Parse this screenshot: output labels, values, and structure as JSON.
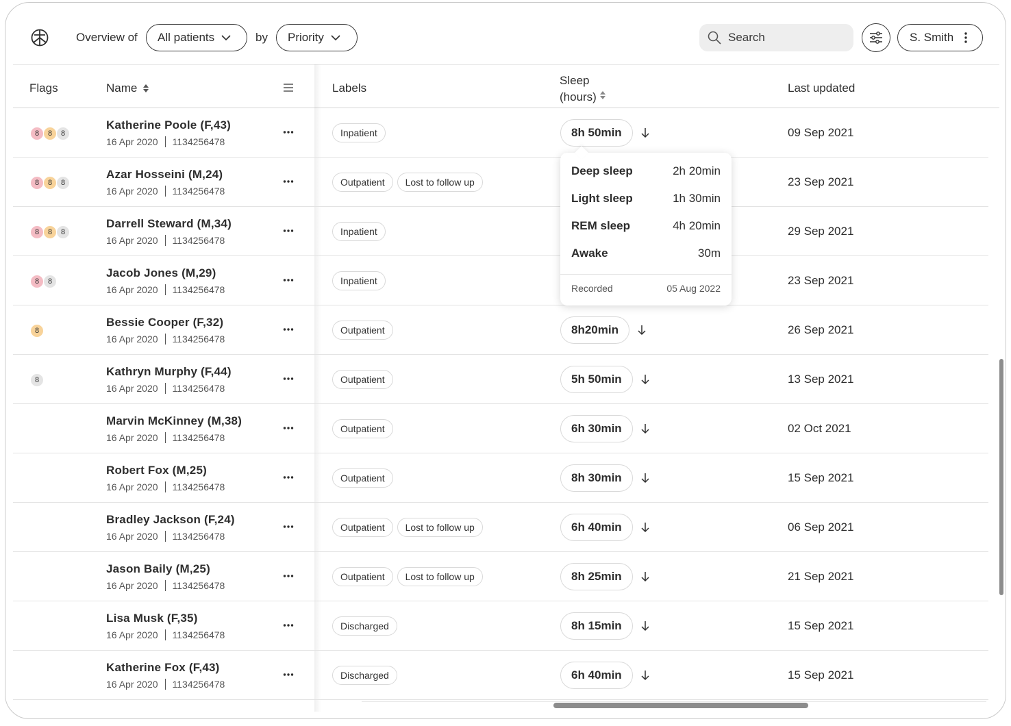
{
  "header": {
    "overview_label": "Overview of",
    "by_label": "by",
    "patients_filter": "All patients",
    "sort_by": "Priority",
    "search_placeholder": "Search",
    "user_name": "S. Smith"
  },
  "table": {
    "columns": {
      "flags": "Flags",
      "name": "Name",
      "labels": "Labels",
      "sleep_line1": "Sleep",
      "sleep_line2": "(hours)",
      "last_updated": "Last updated"
    },
    "rows": [
      {
        "name": "Katherine Poole (F,43)",
        "date": "16 Apr 2020",
        "id": "1134256478",
        "flags": [
          {
            "v": "8",
            "c": "red"
          },
          {
            "v": "8",
            "c": "orange"
          },
          {
            "v": "8",
            "c": "grey"
          }
        ],
        "labels": [
          "Inpatient"
        ],
        "sleep": "8h 50min",
        "updated": "09 Sep 2021"
      },
      {
        "name": "Azar Hosseini (M,24)",
        "date": "16 Apr 2020",
        "id": "1134256478",
        "flags": [
          {
            "v": "8",
            "c": "red"
          },
          {
            "v": "8",
            "c": "orange"
          },
          {
            "v": "8",
            "c": "grey"
          }
        ],
        "labels": [
          "Outpatient",
          "Lost to follow up"
        ],
        "sleep": "",
        "updated": "23 Sep 2021"
      },
      {
        "name": "Darrell Steward (M,34)",
        "date": "16 Apr 2020",
        "id": "1134256478",
        "flags": [
          {
            "v": "8",
            "c": "red"
          },
          {
            "v": "8",
            "c": "orange"
          },
          {
            "v": "8",
            "c": "grey"
          }
        ],
        "labels": [
          "Inpatient"
        ],
        "sleep": "",
        "updated": "29 Sep 2021"
      },
      {
        "name": "Jacob Jones (M,29)",
        "date": "16 Apr 2020",
        "id": "1134256478",
        "flags": [
          {
            "v": "8",
            "c": "red"
          },
          {
            "v": "8",
            "c": "grey"
          }
        ],
        "labels": [
          "Inpatient"
        ],
        "sleep": "",
        "updated": "23 Sep 2021"
      },
      {
        "name": "Bessie Cooper (F,32)",
        "date": "16 Apr 2020",
        "id": "1134256478",
        "flags": [
          {
            "v": "8",
            "c": "orange"
          }
        ],
        "labels": [
          "Outpatient"
        ],
        "sleep": "8h20min",
        "updated": "26 Sep 2021"
      },
      {
        "name": "Kathryn Murphy (F,44)",
        "date": "16 Apr 2020",
        "id": "1134256478",
        "flags": [
          {
            "v": "8",
            "c": "grey"
          }
        ],
        "labels": [
          "Outpatient"
        ],
        "sleep": "5h 50min",
        "updated": "13 Sep 2021"
      },
      {
        "name": "Marvin McKinney (M,38)",
        "date": "16 Apr 2020",
        "id": "1134256478",
        "flags": [],
        "labels": [
          "Outpatient"
        ],
        "sleep": "6h 30min",
        "updated": "02 Oct 2021"
      },
      {
        "name": "Robert Fox (M,25)",
        "date": "16 Apr 2020",
        "id": "1134256478",
        "flags": [],
        "labels": [
          "Outpatient"
        ],
        "sleep": "8h 30min",
        "updated": "15 Sep 2021"
      },
      {
        "name": "Bradley Jackson (F,24)",
        "date": "16 Apr 2020",
        "id": "1134256478",
        "flags": [],
        "labels": [
          "Outpatient",
          "Lost to follow up"
        ],
        "sleep": "6h 40min",
        "updated": "06 Sep 2021"
      },
      {
        "name": "Jason Baily (M,25)",
        "date": "16 Apr 2020",
        "id": "1134256478",
        "flags": [],
        "labels": [
          "Outpatient",
          "Lost to follow up"
        ],
        "sleep": "8h 25min",
        "updated": "21 Sep 2021"
      },
      {
        "name": "Lisa Musk (F,35)",
        "date": "16 Apr 2020",
        "id": "1134256478",
        "flags": [],
        "labels": [
          "Discharged"
        ],
        "sleep": "8h 15min",
        "updated": "15 Sep 2021"
      },
      {
        "name": "Katherine Fox (F,43)",
        "date": "16 Apr 2020",
        "id": "1134256478",
        "flags": [],
        "labels": [
          "Discharged"
        ],
        "sleep": "6h 40min",
        "updated": "15 Sep 2021"
      }
    ]
  },
  "sleep_popover": {
    "items": [
      {
        "label": "Deep sleep",
        "value": "2h 20min"
      },
      {
        "label": "Light sleep",
        "value": "1h 30min"
      },
      {
        "label": "REM sleep",
        "value": "4h 20min"
      },
      {
        "label": "Awake",
        "value": "30m"
      }
    ],
    "recorded_label": "Recorded",
    "recorded_date": "05 Aug 2022"
  },
  "colors": {
    "flag_red": "#f4bcc4",
    "flag_orange": "#f8d39a",
    "flag_grey": "#e4e4e4"
  }
}
